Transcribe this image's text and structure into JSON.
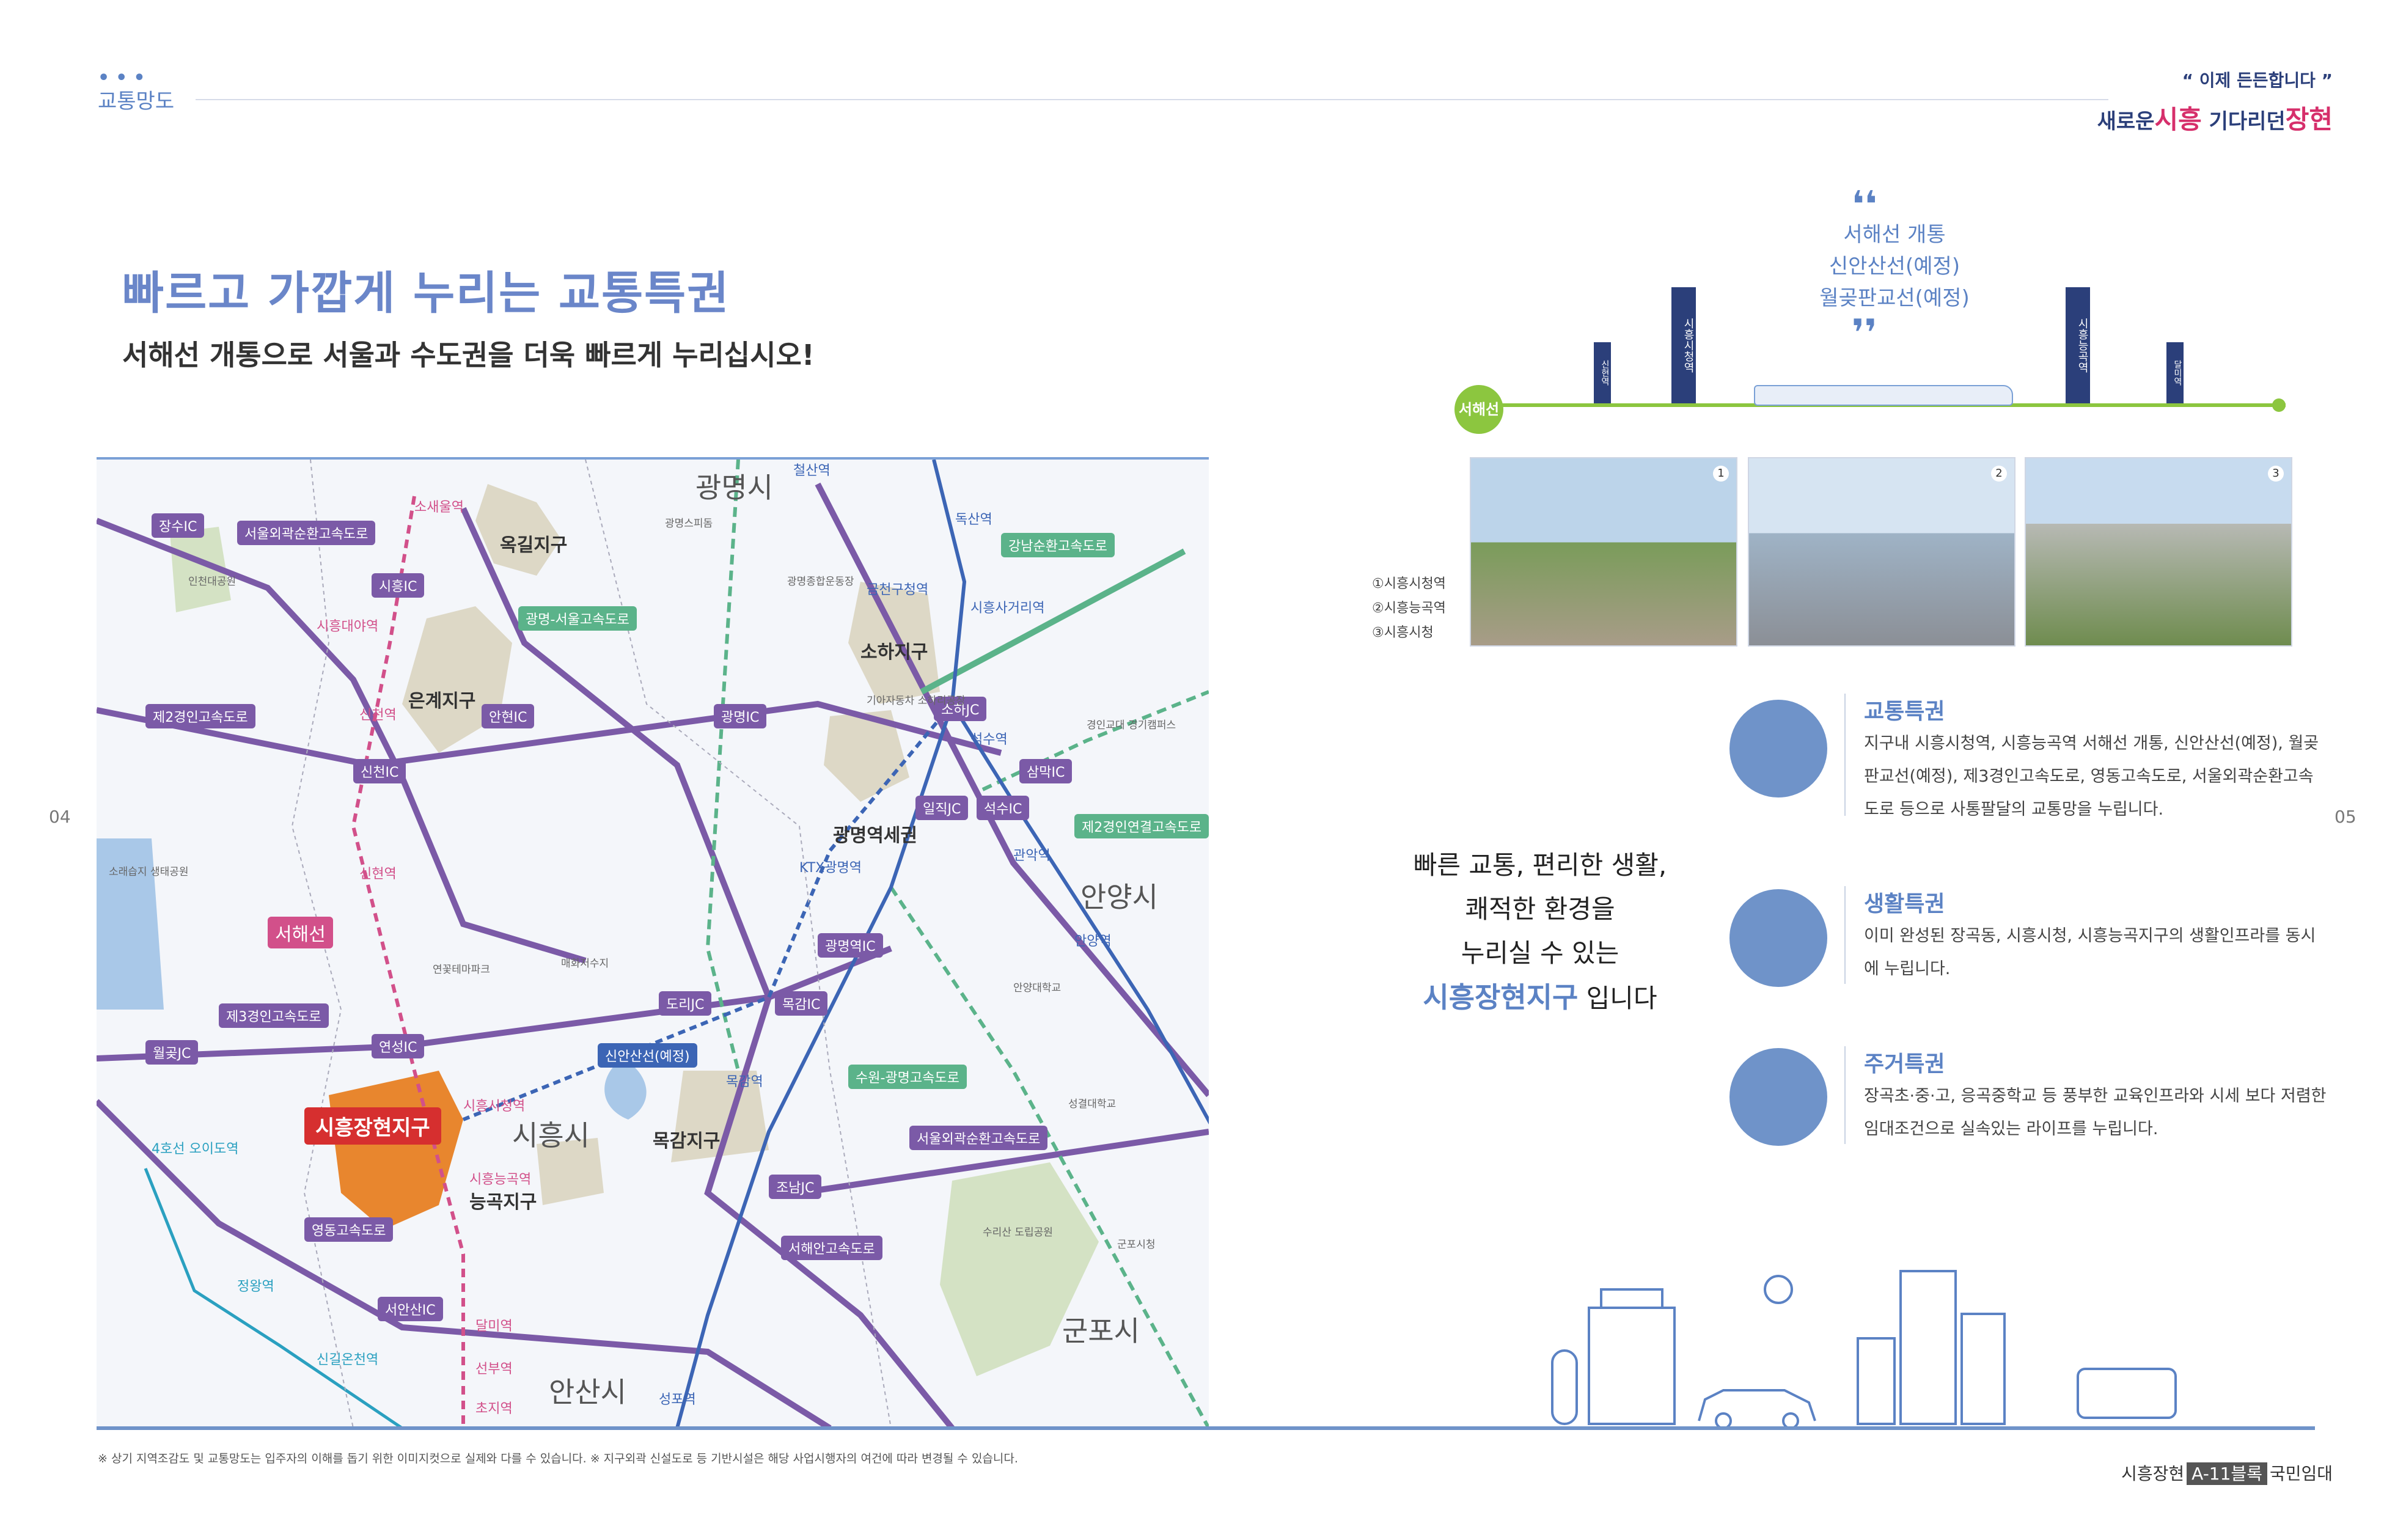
{
  "header": {
    "section_label": "교통망도",
    "tagline": "“ 이제 든든합니다 ”",
    "brand_prefix": "새로운",
    "brand_city": "시흥",
    "brand_mid": "기다리던",
    "brand_place": "장현"
  },
  "main": {
    "title": "빠르고 가깝게 누리는 교통특권",
    "subtitle": "서해선 개통으로 서울과 수도권을 더욱 빠르게 누리십시오!"
  },
  "map": {
    "cities": [
      "광명시",
      "안양시",
      "시흥시",
      "군포시",
      "안산시"
    ],
    "districts": [
      "옥길지구",
      "은계지구",
      "소하지구",
      "광명역세권",
      "목감지구",
      "능곡지구"
    ],
    "roads": [
      "서울외곽순환고속도로",
      "광명-서울고속도로",
      "강남순환고속도로",
      "제2경인고속도로",
      "제3경인고속도로",
      "제2경인연결고속도로",
      "수원-광명고속도로",
      "서울외곽순환고속도로",
      "영동고속도로",
      "서해안고속도로"
    ],
    "ics": [
      "장수IC",
      "시흥IC",
      "안현IC",
      "광명IC",
      "소하JC",
      "신천IC",
      "일직JC",
      "석수IC",
      "삼막IC",
      "광명역IC",
      "도리JC",
      "목감IC",
      "연성IC",
      "월곶JC",
      "조남JC",
      "서안산IC"
    ],
    "lines": [
      "서해선",
      "신안산선(예정)"
    ],
    "pink_stations": [
      "소새울역",
      "시흥대야역",
      "신천역",
      "신현역",
      "시흥시청역",
      "시흥능곡역",
      "달미역",
      "선부역",
      "초지역"
    ],
    "blue_stations": [
      "철산역",
      "독산역",
      "금천구청역",
      "시흥사거리역",
      "석수역",
      "관악역",
      "안양역",
      "KTX광명역",
      "목감역",
      "성포역"
    ],
    "teal_stations": [
      "4호선 오이도역",
      "정왕역",
      "신길온천역"
    ],
    "pois": [
      "광명스피돔",
      "광명종합운동장",
      "인천대공원",
      "기아자동차 소하리공장",
      "경인교대 경기캠퍼스",
      "소래습지 생태공원",
      "연꽃테마파크",
      "매화저수지",
      "안양대학교",
      "성결대학교",
      "수리산 도립공원",
      "군포시청"
    ],
    "target": "시흥장현지구"
  },
  "side": {
    "quote_lines": [
      "서해선 개통",
      "신안산선(예정)",
      "월곶판교선(예정)"
    ],
    "line_tag": "서해선",
    "sign_labels": [
      "신현역",
      "시흥시청역",
      "시흥능곡역",
      "달미역"
    ],
    "photo_nums": [
      "1",
      "2",
      "3"
    ],
    "photo_captions": [
      "①시흥시청역",
      "②시흥능곡역",
      "③시흥시청"
    ],
    "slogan_lines": [
      "빠른 교통, 편리한 생활,",
      "쾌적한 환경을",
      "누리실 수 있는"
    ],
    "slogan_highlight": "시흥장현지구",
    "slogan_suffix": " 입니다",
    "features": [
      {
        "title": "교통특권",
        "body": "지구내 시흥시청역, 시흥능곡역 서해선 개통, 신안산선(예정), 월곶판교선(예정), 제3경인고속도로, 영동고속도로, 서울외곽순환고속도로 등으로 사통팔달의 교통망을 누립니다."
      },
      {
        "title": "생활특권",
        "body": "이미 완성된 장곡동, 시흥시청, 시흥능곡지구의 생활인프라를 동시에 누립니다."
      },
      {
        "title": "주거특권",
        "body": "장곡초·중·고, 응곡중학교 등 풍부한 교육인프라와 시세 보다 저렴한 임대조건으로 실속있는 라이프를 누립니다."
      }
    ]
  },
  "footer": {
    "note": "※ 상기 지역조감도 및 교통망도는 입주자의 이해를 돕기 위한 이미지컷으로 실제와 다를 수 있습니다.   ※ 지구외곽 신설도로 등 기반시설은 해당 사업시행자의 여건에 따라 변경될 수 있습니다.",
    "page_left": "04",
    "page_right": "05",
    "brand_a": "시흥장현",
    "brand_box": "A-11블록",
    "brand_b": "국민임대"
  },
  "colors": {
    "accent": "#5b82c4",
    "road": "#7b5aa7",
    "seohae_line": "#d2508a",
    "target": "#e8862e"
  }
}
